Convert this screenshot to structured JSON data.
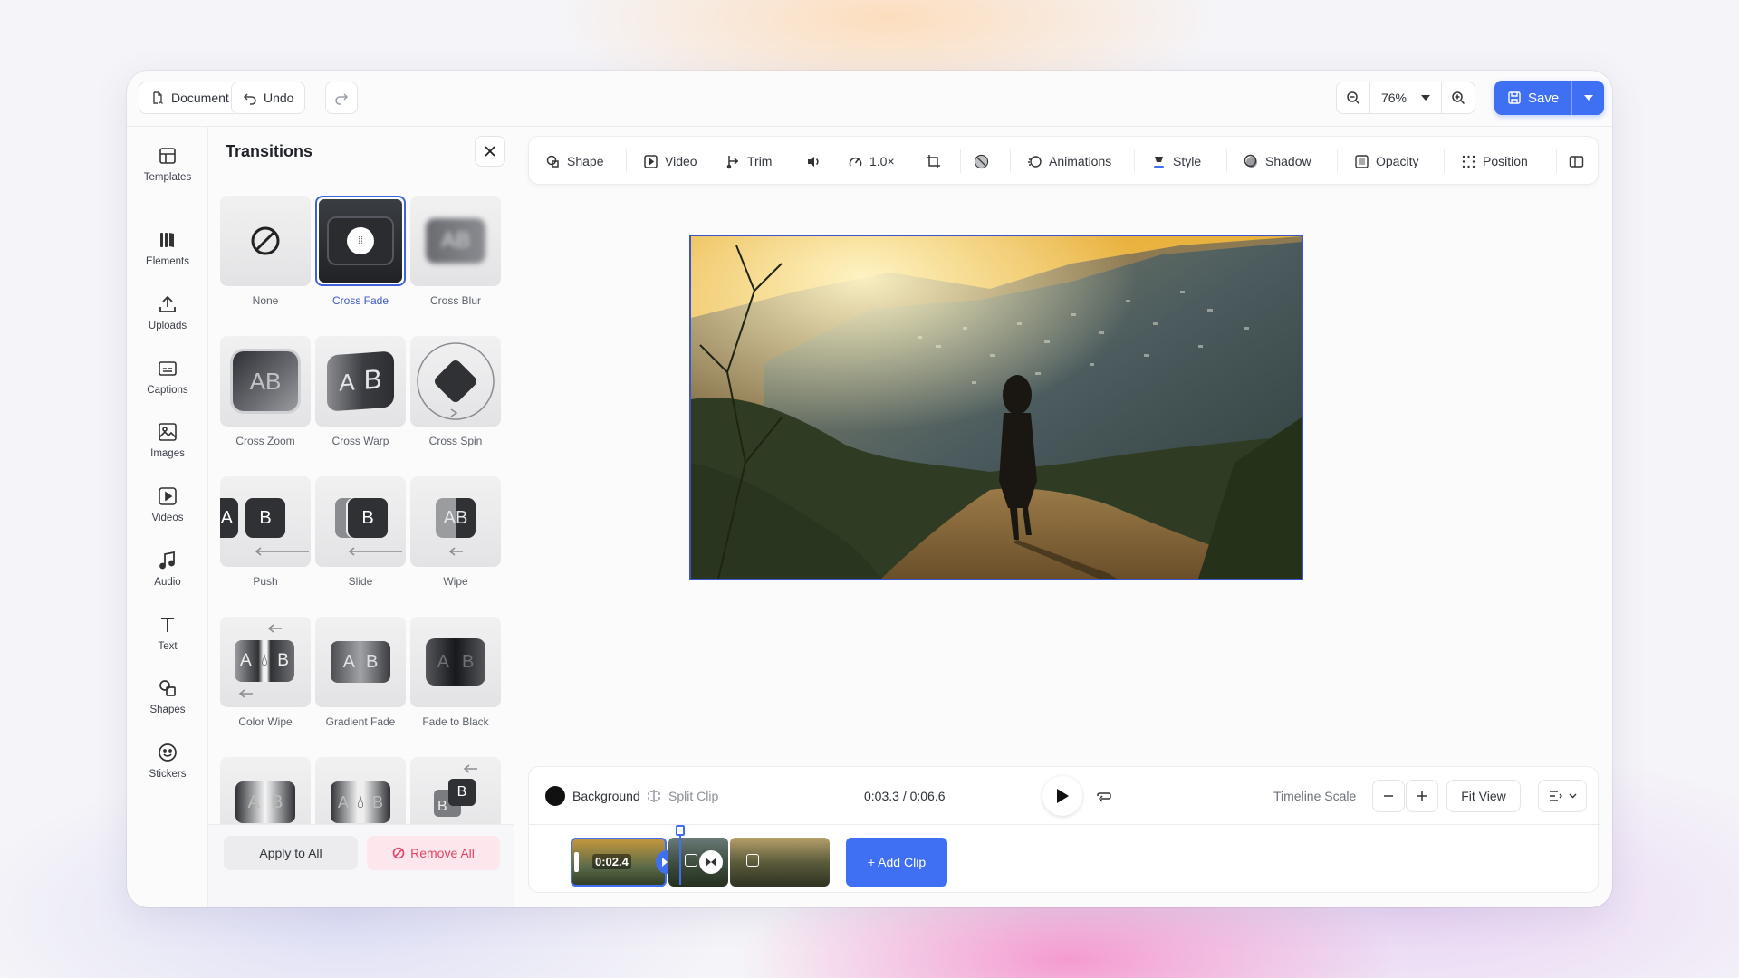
{
  "topbar": {
    "document_label": "Document",
    "undo_label": "Undo",
    "zoom_value": "76%",
    "save_label": "Save"
  },
  "rail": {
    "items": [
      {
        "label": "Templates",
        "icon": "templates-icon"
      },
      {
        "label": "Elements",
        "icon": "elements-icon"
      },
      {
        "label": "Uploads",
        "icon": "upload-icon"
      },
      {
        "label": "Captions",
        "icon": "captions-icon"
      },
      {
        "label": "Images",
        "icon": "image-icon"
      },
      {
        "label": "Videos",
        "icon": "video-icon"
      },
      {
        "label": "Audio",
        "icon": "music-icon"
      },
      {
        "label": "Text",
        "icon": "text-icon"
      },
      {
        "label": "Shapes",
        "icon": "shapes-icon"
      },
      {
        "label": "Stickers",
        "icon": "sticker-icon"
      }
    ]
  },
  "panel": {
    "title": "Transitions",
    "transitions": [
      {
        "label": "None"
      },
      {
        "label": "Cross Fade",
        "selected": true
      },
      {
        "label": "Cross Blur"
      },
      {
        "label": "Cross Zoom"
      },
      {
        "label": "Cross Warp"
      },
      {
        "label": "Cross Spin"
      },
      {
        "label": "Push"
      },
      {
        "label": "Slide"
      },
      {
        "label": "Wipe"
      },
      {
        "label": "Color Wipe"
      },
      {
        "label": "Gradient Fade"
      },
      {
        "label": "Fade to Black"
      },
      {
        "label": ""
      },
      {
        "label": ""
      },
      {
        "label": ""
      }
    ],
    "apply_all_label": "Apply to All",
    "remove_all_label": "Remove All"
  },
  "toolbar": {
    "shape_label": "Shape",
    "video_label": "Video",
    "trim_label": "Trim",
    "speed_label": "1.0×",
    "animations_label": "Animations",
    "style_label": "Style",
    "shadow_label": "Shadow",
    "opacity_label": "Opacity",
    "position_label": "Position"
  },
  "timeline": {
    "background_label": "Background",
    "split_clip_label": "Split Clip",
    "time_display": "0:03.3 / 0:06.6",
    "scale_label": "Timeline Scale",
    "fit_view_label": "Fit View",
    "clip_time": "0:02.4",
    "add_clip_label": "+ Add Clip"
  },
  "colors": {
    "accent": "#3f6ff2",
    "selection": "#3c56c8",
    "danger": "#e04466"
  }
}
